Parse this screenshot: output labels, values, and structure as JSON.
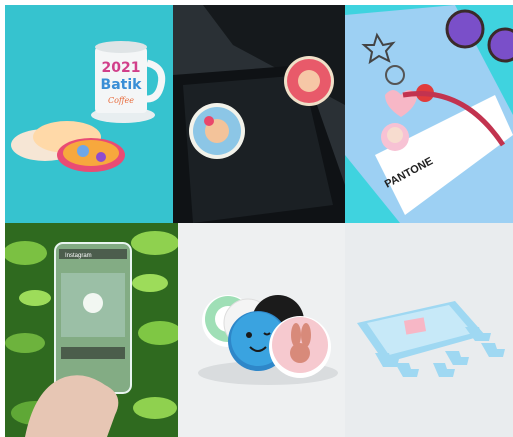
{
  "tiles": [
    {
      "mug_year": "2021",
      "mug_word": "Batik",
      "mug_script": "Coffee"
    },
    {},
    {
      "card_brand": "PANTONE"
    },
    {
      "phone_app": "Instagram"
    },
    {},
    {}
  ],
  "colors": {
    "teal": "#36c3cf",
    "dark": "#1f2428",
    "aqua": "#3fd3df",
    "leaf": "#4a8f2a",
    "pink": "#f7b7c6",
    "purple": "#7a4fc9"
  }
}
